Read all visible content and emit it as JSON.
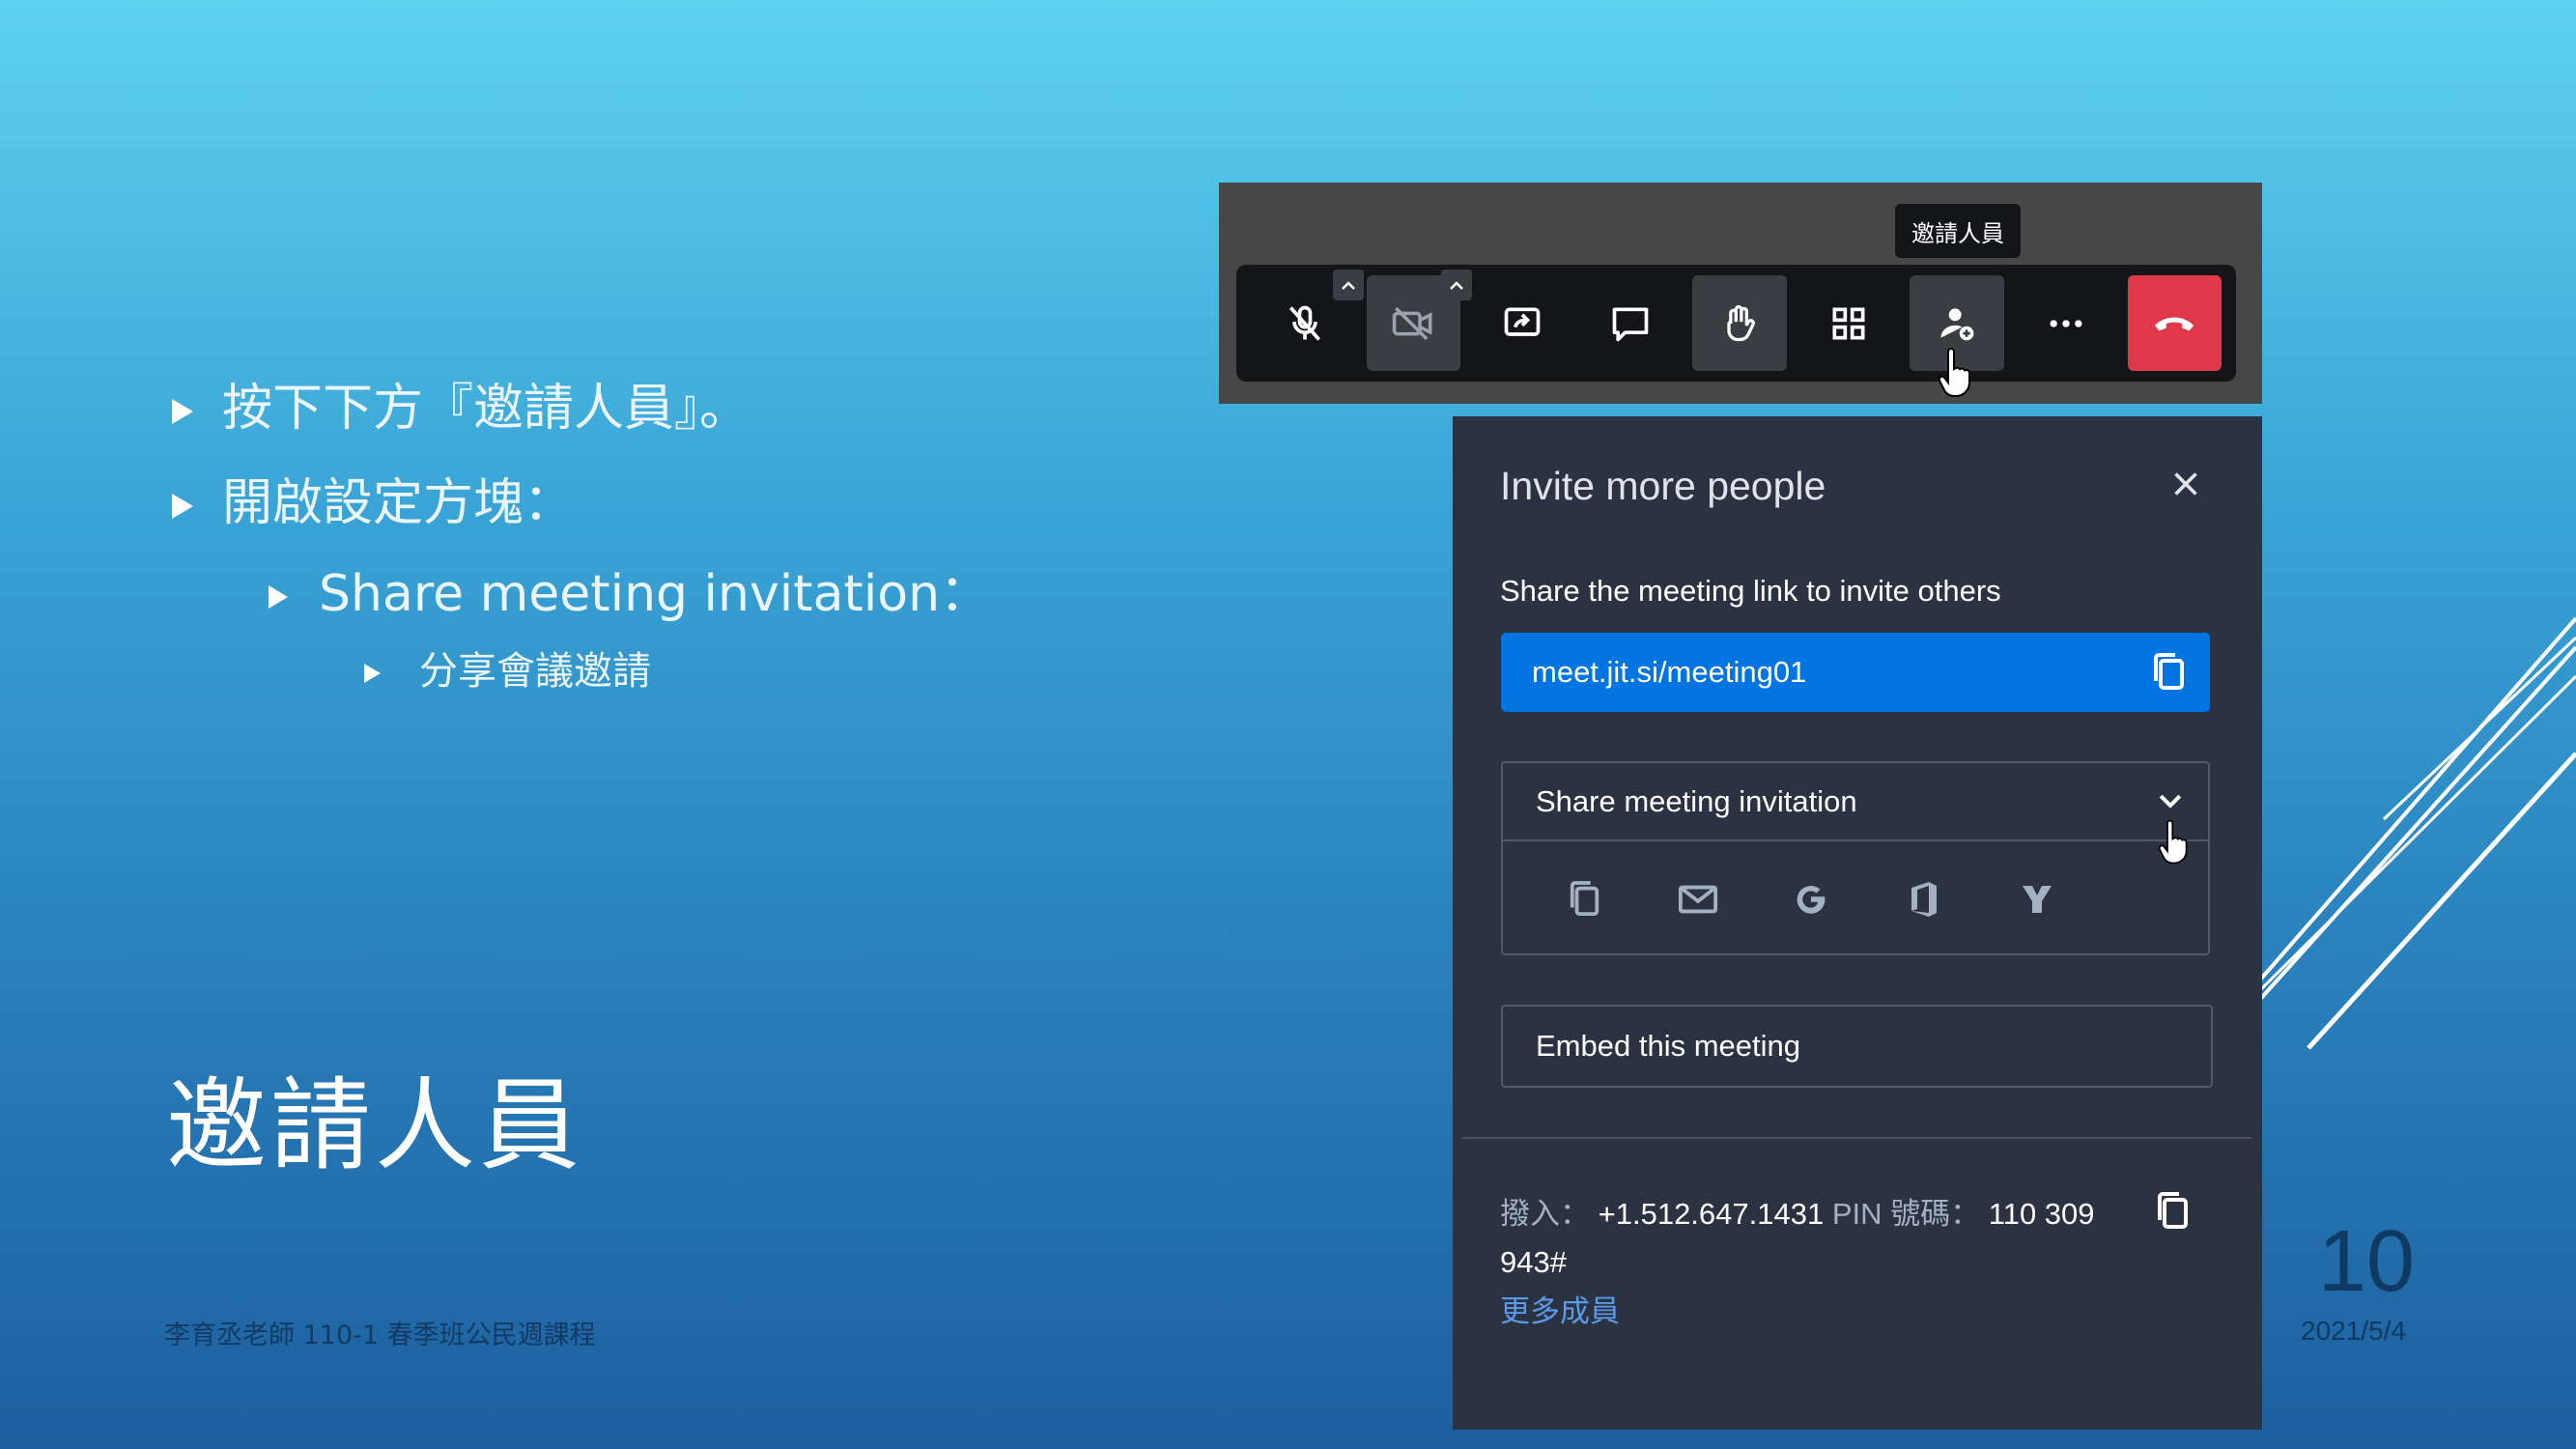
{
  "slide": {
    "bullets": [
      {
        "level": 1,
        "text": "按下下方『邀請人員』。"
      },
      {
        "level": 1,
        "text": "開啟設定方塊："
      },
      {
        "level": 2,
        "text": "Share meeting invitation："
      },
      {
        "level": 3,
        "text": "分享會議邀請"
      }
    ],
    "title": "邀請人員",
    "footer": "李育丞老師 110-1 春季班公民週課程",
    "page_number": "10",
    "date": "2021/5/4"
  },
  "toolbar": {
    "tooltip": "邀請人員",
    "buttons": [
      "microphone-muted-icon",
      "camera-off-icon",
      "share-screen-icon",
      "chat-icon",
      "raise-hand-icon",
      "tile-view-icon",
      "invite-people-icon",
      "more-icon",
      "hangup-icon"
    ]
  },
  "dialog": {
    "title": "Invite more people",
    "share_link_label": "Share the meeting link to invite others",
    "meeting_link": "meet.jit.si/meeting01",
    "share_invitation_label": "Share meeting invitation",
    "share_options": [
      "copy-icon",
      "email-icon",
      "google-icon",
      "outlook-icon",
      "yahoo-icon"
    ],
    "embed_label": "Embed this meeting",
    "dial_in_label": "撥入：",
    "dial_in_number": "+1.512.647.1431",
    "pin_label": "PIN 號碼：",
    "pin_value_1": "110 309",
    "pin_value_2": "943#",
    "more_numbers": "更多成員"
  },
  "colors": {
    "link_bg": "#0074e0",
    "hangup": "#e0374a",
    "dialog_bg": "#2b3242"
  }
}
